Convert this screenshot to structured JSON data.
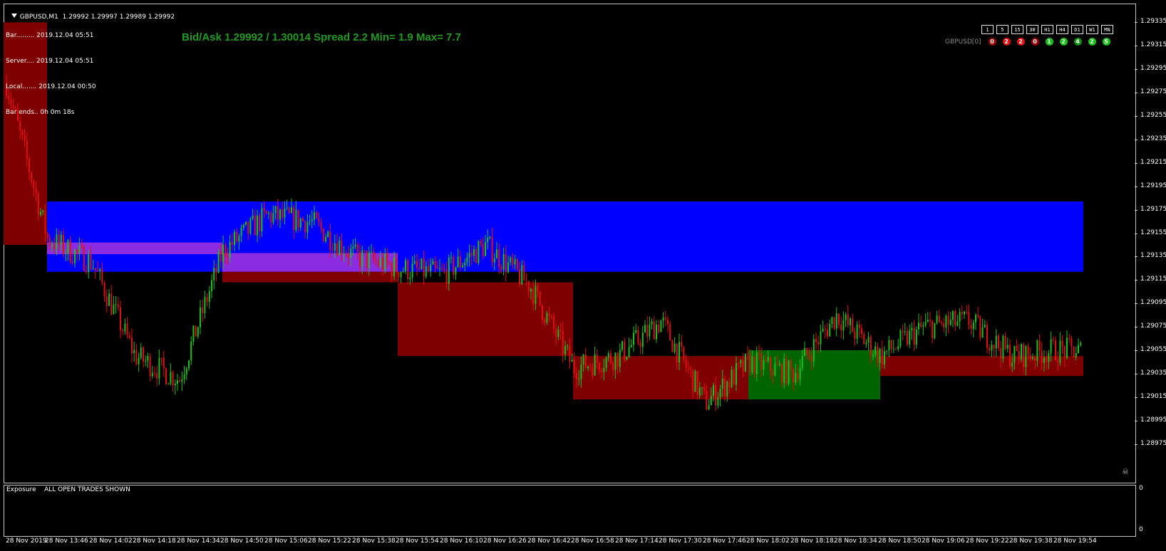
{
  "header": {
    "symbol_line": "GBPUSD,M1  1.29992 1.29997 1.29989 1.29992",
    "bar_info": [
      "Bar......... 2019.12.04 05:51",
      "Server.... 2019.12.04 05:51",
      "Local....... 2019.12.04 00:50",
      "Bar ends.. 0h 0m 18s"
    ],
    "bidask": "Bid/Ask 1.29992 / 1.30014  Spread 2.2  Min= 1.9  Max= 7.7"
  },
  "timeframes": [
    "1",
    "5",
    "15",
    "30",
    "H1",
    "H4",
    "D1",
    "W1",
    "MN"
  ],
  "strength": {
    "label": "GBPUSD[0]",
    "dots": [
      {
        "value": "0",
        "color": "#a00000"
      },
      {
        "value": "2",
        "color": "#e01010"
      },
      {
        "value": "2",
        "color": "#e01010"
      },
      {
        "value": "0",
        "color": "#a00000"
      },
      {
        "value": "1",
        "color": "#19c219"
      },
      {
        "value": "2",
        "color": "#19c219"
      },
      {
        "value": "4",
        "color": "#0f8f0f"
      },
      {
        "value": "2",
        "color": "#19c219"
      },
      {
        "value": "5",
        "color": "#19c219"
      }
    ]
  },
  "price_axis": [
    "1.29335",
    "1.29315",
    "1.29295",
    "1.29275",
    "1.29255",
    "1.29235",
    "1.29215",
    "1.29195",
    "1.29175",
    "1.29155",
    "1.29135",
    "1.29115",
    "1.29095",
    "1.29075",
    "1.29055",
    "1.29035",
    "1.29015",
    "1.28995",
    "1.28975"
  ],
  "time_axis": [
    "28 Nov 2019",
    "28 Nov 13:46",
    "28 Nov 14:02",
    "28 Nov 14:18",
    "28 Nov 14:34",
    "28 Nov 14:50",
    "28 Nov 15:06",
    "28 Nov 15:22",
    "28 Nov 15:38",
    "28 Nov 15:54",
    "28 Nov 16:10",
    "28 Nov 16:26",
    "28 Nov 16:42",
    "28 Nov 16:58",
    "28 Nov 17:14",
    "28 Nov 17:30",
    "28 Nov 17:46",
    "28 Nov 18:02",
    "28 Nov 18:18",
    "28 Nov 18:34",
    "28 Nov 18:50",
    "28 Nov 19:06",
    "28 Nov 19:22",
    "28 Nov 19:38",
    "28 Nov 19:54"
  ],
  "subwindow": {
    "exposure_label": "Exposure    ALL OPEN TRADES SHOWN",
    "axis_top": "0",
    "axis_bottom": "0"
  },
  "colors": {
    "bull": "#19c219",
    "bear": "#e01010",
    "supply_zone": "#0000ff",
    "overlap_zone": "#8b2be2",
    "demand_zone_dark": "#7f0000",
    "green_zone": "#006400",
    "text_green": "#1f9b1f"
  },
  "chart_data": {
    "type": "candlestick",
    "symbol": "GBPUSD",
    "timeframe": "M1",
    "ylim": [
      1.28965,
      1.29345
    ],
    "ticks": [
      "1.29335",
      "1.29315",
      "1.29295",
      "1.29275",
      "1.29255",
      "1.29235",
      "1.29215",
      "1.29195",
      "1.29175",
      "1.29155",
      "1.29135",
      "1.29115",
      "1.29095",
      "1.29075",
      "1.29055",
      "1.29035",
      "1.29015",
      "1.28995",
      "1.28975"
    ],
    "zones": [
      {
        "name": "zone-1",
        "from": "28 Nov 2019",
        "to": "28 Nov 13:46",
        "low": 1.29145,
        "high": 1.29335,
        "color": "#7f0000"
      },
      {
        "name": "zone-2",
        "from": "28 Nov 13:46",
        "to": "28 Nov 19:54",
        "low": 1.29122,
        "high": 1.29182,
        "color": "#0000ff"
      },
      {
        "name": "zone-3",
        "from": "28 Nov 13:46",
        "to": "28 Nov 14:50",
        "low": 1.29137,
        "high": 1.29147,
        "color": "#8b2be2"
      },
      {
        "name": "zone-4",
        "from": "28 Nov 14:50",
        "to": "28 Nov 15:54",
        "low": 1.29122,
        "high": 1.29138,
        "color": "#8b2be2"
      },
      {
        "name": "zone-5",
        "from": "28 Nov 14:50",
        "to": "28 Nov 15:54",
        "low": 1.29113,
        "high": 1.29122,
        "color": "#7f0000"
      },
      {
        "name": "zone-6",
        "from": "28 Nov 15:54",
        "to": "28 Nov 16:58",
        "low": 1.2905,
        "high": 1.29113,
        "color": "#7f0000"
      },
      {
        "name": "zone-7",
        "from": "28 Nov 16:58",
        "to": "28 Nov 18:02",
        "low": 1.29013,
        "high": 1.2905,
        "color": "#7f0000"
      },
      {
        "name": "zone-8",
        "from": "28 Nov 18:02",
        "to": "28 Nov 18:50",
        "low": 1.29013,
        "high": 1.29055,
        "color": "#006400"
      },
      {
        "name": "zone-9",
        "from": "28 Nov 18:50",
        "to": "28 Nov 19:54",
        "low": 1.29033,
        "high": 1.2905,
        "color": "#7f0000"
      }
    ],
    "path_anchors": [
      {
        "t": "28 Nov 2019",
        "p": 1.2929
      },
      {
        "t": "28 Nov 13:46",
        "p": 1.2915
      },
      {
        "t": "28 Nov 14:02",
        "p": 1.2913
      },
      {
        "t": "28 Nov 14:18",
        "p": 1.2905
      },
      {
        "t": "28 Nov 14:34",
        "p": 1.2903
      },
      {
        "t": "28 Nov 14:50",
        "p": 1.2914
      },
      {
        "t": "28 Nov 15:06",
        "p": 1.2917
      },
      {
        "t": "28 Nov 15:22",
        "p": 1.29165
      },
      {
        "t": "28 Nov 15:38",
        "p": 1.29135
      },
      {
        "t": "28 Nov 15:54",
        "p": 1.29125
      },
      {
        "t": "28 Nov 16:10",
        "p": 1.2912
      },
      {
        "t": "28 Nov 16:26",
        "p": 1.29145
      },
      {
        "t": "28 Nov 16:42",
        "p": 1.2911
      },
      {
        "t": "28 Nov 16:58",
        "p": 1.2904
      },
      {
        "t": "28 Nov 17:14",
        "p": 1.2905
      },
      {
        "t": "28 Nov 17:30",
        "p": 1.2908
      },
      {
        "t": "28 Nov 17:46",
        "p": 1.2901
      },
      {
        "t": "28 Nov 18:02",
        "p": 1.29045
      },
      {
        "t": "28 Nov 18:18",
        "p": 1.29035
      },
      {
        "t": "28 Nov 18:34",
        "p": 1.29085
      },
      {
        "t": "28 Nov 18:50",
        "p": 1.2905
      },
      {
        "t": "28 Nov 19:06",
        "p": 1.29075
      },
      {
        "t": "28 Nov 19:22",
        "p": 1.2908
      },
      {
        "t": "28 Nov 19:38",
        "p": 1.2905
      },
      {
        "t": "28 Nov 19:54",
        "p": 1.29055
      }
    ],
    "last_price": 1.29992
  }
}
